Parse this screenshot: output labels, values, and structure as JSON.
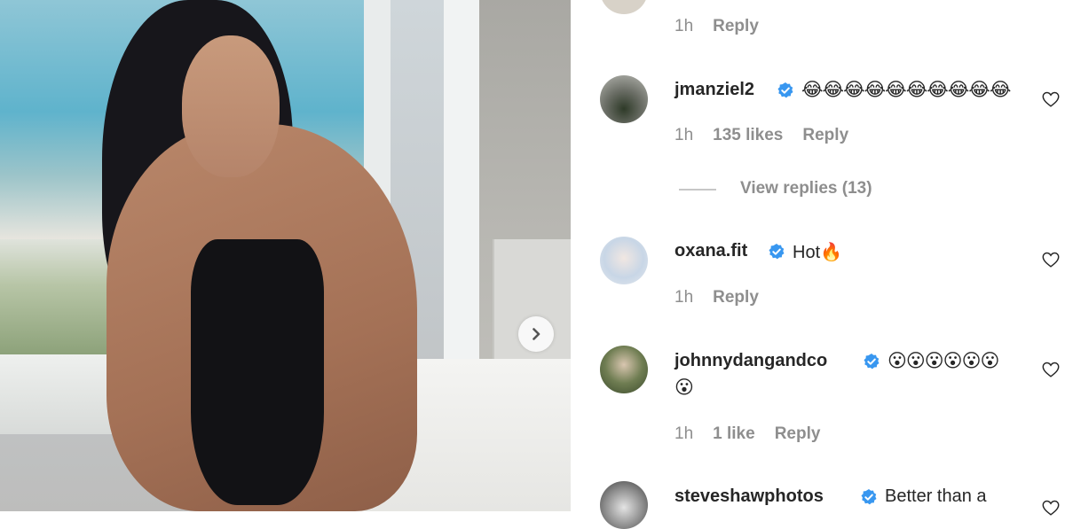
{
  "post_image": {
    "next_icon": "chevron-right-icon"
  },
  "comments": [
    {
      "id": "c0",
      "meta": {
        "time": "1h",
        "reply": "Reply"
      }
    },
    {
      "id": "c1",
      "username": "jmanziel2",
      "verified": true,
      "text": "😂😂😂😂😂😂😂😂😂😂",
      "meta": {
        "time": "1h",
        "likes": "135 likes",
        "reply": "Reply"
      },
      "view_replies": "View replies (13)"
    },
    {
      "id": "c2",
      "username": "oxana.fit",
      "verified": true,
      "text": "Hot🔥",
      "meta": {
        "time": "1h",
        "reply": "Reply"
      }
    },
    {
      "id": "c3",
      "username": "johnnydangandco",
      "verified": true,
      "text_line1": "😮😮😮😮😮😮",
      "text_line2": "😮",
      "meta": {
        "time": "1h",
        "likes": "1 like",
        "reply": "Reply"
      }
    },
    {
      "id": "c4",
      "username": "steveshawphotos",
      "verified": true,
      "text": "Better than a"
    }
  ],
  "colors": {
    "verified_blue": "#3897f0",
    "meta_gray": "#8e8e8e",
    "text": "#262626"
  }
}
